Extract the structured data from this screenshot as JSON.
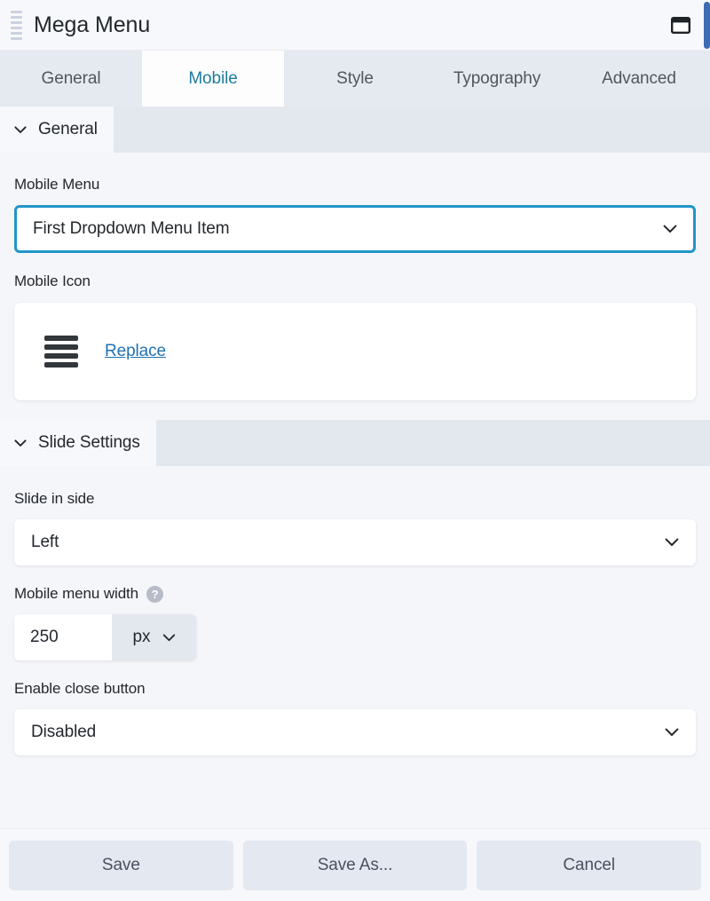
{
  "window": {
    "title": "Mega Menu",
    "drag_handle_icon": "drag-handle-icon",
    "window_icon": "browser-window-icon"
  },
  "tabs": [
    {
      "label": "General",
      "active": false
    },
    {
      "label": "Mobile",
      "active": true
    },
    {
      "label": "Style",
      "active": false
    },
    {
      "label": "Typography",
      "active": false
    },
    {
      "label": "Advanced",
      "active": false
    }
  ],
  "sections": {
    "general": {
      "title": "General",
      "chevron_icon": "chevron-down-icon",
      "mobile_menu": {
        "label": "Mobile Menu",
        "value": "First Dropdown Menu Item",
        "chevron_icon": "chevron-down-icon"
      },
      "mobile_icon": {
        "label": "Mobile Icon",
        "icon_name": "hamburger-menu-icon",
        "replace_label": "Replace"
      }
    },
    "slide_settings": {
      "title": "Slide Settings",
      "chevron_icon": "chevron-down-icon",
      "slide_in_side": {
        "label": "Slide in side",
        "value": "Left",
        "chevron_icon": "chevron-down-icon"
      },
      "mobile_menu_width": {
        "label": "Mobile menu width",
        "help_icon": "help-circle-icon",
        "help_glyph": "?",
        "value": "250",
        "unit": "px",
        "chevron_icon": "chevron-down-icon"
      },
      "enable_close_button": {
        "label": "Enable close button",
        "value": "Disabled",
        "chevron_icon": "chevron-down-icon"
      }
    }
  },
  "footer": {
    "save_label": "Save",
    "save_as_label": "Save As...",
    "cancel_label": "Cancel"
  },
  "colors": {
    "accent": "#1c7c9c",
    "focus_border": "#2196c8",
    "link": "#2271b1",
    "scrollbar": "#3b6cb4",
    "panel_bg": "#f5f6fa",
    "accordion_bg": "#e3e8ef"
  }
}
